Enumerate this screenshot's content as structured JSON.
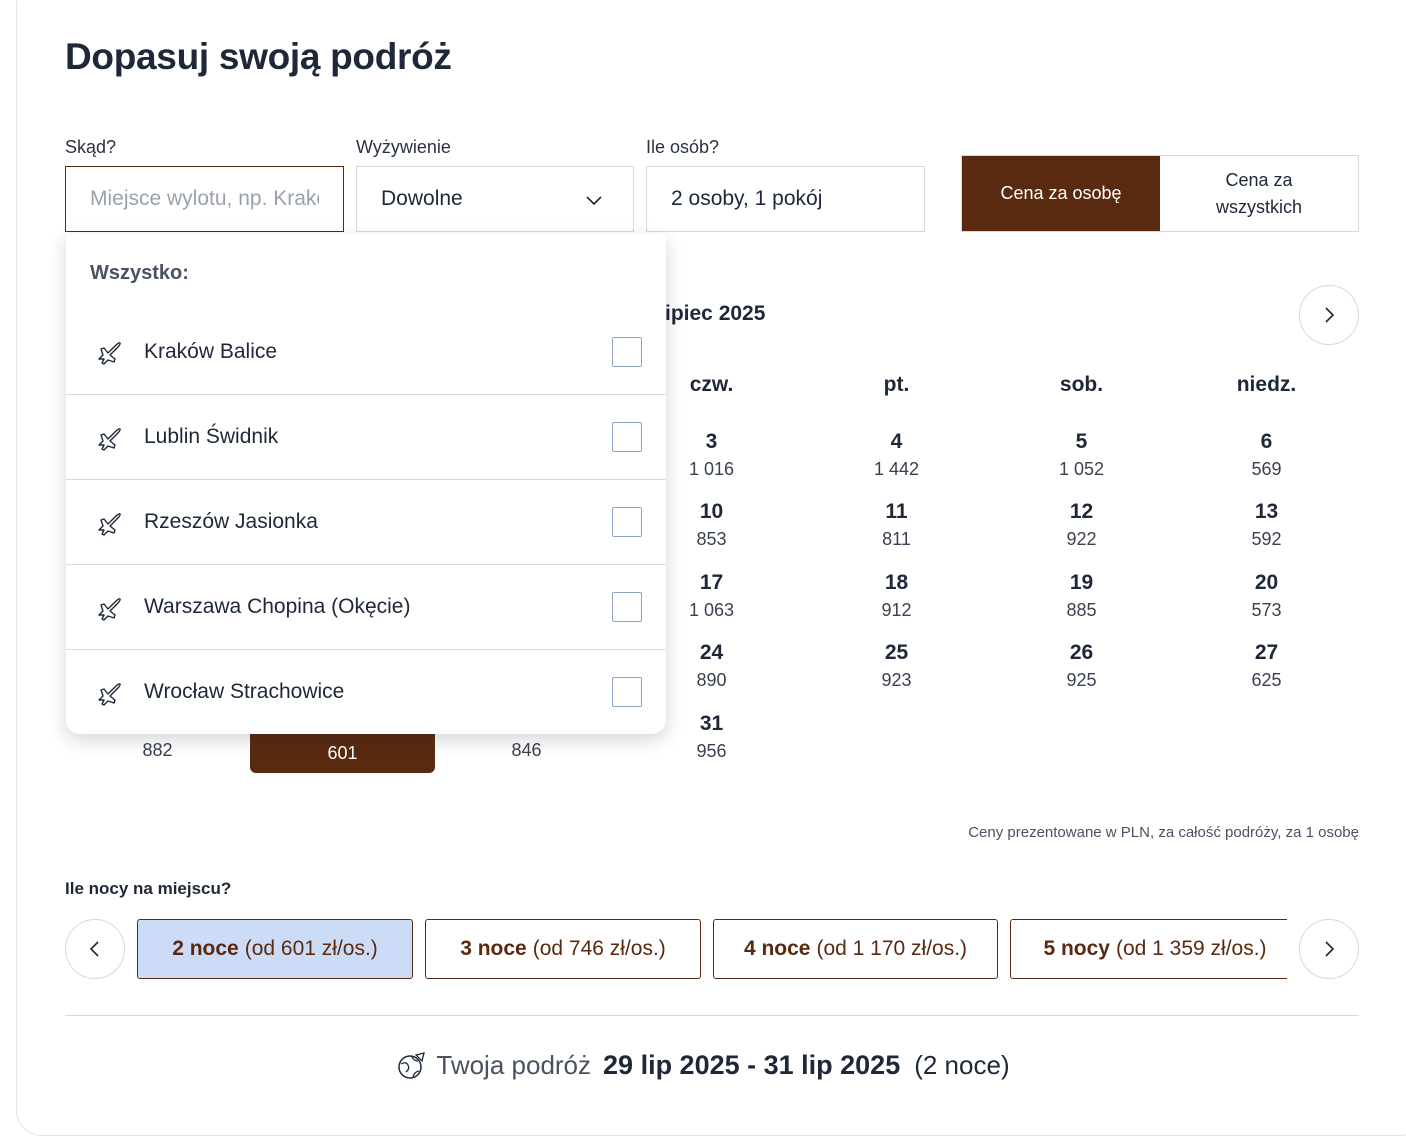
{
  "title": "Dopasuj swoją podróż",
  "from": {
    "label": "Skąd?",
    "placeholder": "Miejsce wylotu, np. Kraków"
  },
  "board": {
    "label": "Wyżywienie",
    "value": "Dowolne"
  },
  "people": {
    "label": "Ile osób?",
    "value": "2 osoby, 1 pokój"
  },
  "price_mode": {
    "per_person": "Cena za osobę",
    "total_line1": "Cena za",
    "total_line2": "wszystkich"
  },
  "calendar": {
    "month": "ipiec 2025",
    "weekdays": [
      "czw.",
      "pt.",
      "sob.",
      "niedz."
    ],
    "rows": [
      [
        {
          "d": "3",
          "p": "1 016"
        },
        {
          "d": "4",
          "p": "1 442"
        },
        {
          "d": "5",
          "p": "1 052"
        },
        {
          "d": "6",
          "p": "569"
        }
      ],
      [
        {
          "d": "10",
          "p": "853"
        },
        {
          "d": "11",
          "p": "811"
        },
        {
          "d": "12",
          "p": "922"
        },
        {
          "d": "13",
          "p": "592"
        }
      ],
      [
        {
          "d": "17",
          "p": "1 063"
        },
        {
          "d": "18",
          "p": "912"
        },
        {
          "d": "19",
          "p": "885"
        },
        {
          "d": "20",
          "p": "573"
        }
      ],
      [
        {
          "d": "24",
          "p": "890"
        },
        {
          "d": "25",
          "p": "923"
        },
        {
          "d": "26",
          "p": "925"
        },
        {
          "d": "27",
          "p": "625"
        }
      ],
      [
        {
          "d": "31",
          "p": "956"
        }
      ]
    ],
    "last_row_prices": [
      "882",
      "601",
      "846"
    ],
    "note": "Ceny prezentowane w PLN, za całość podróży, za 1 osobę"
  },
  "dropdown": {
    "header": "Wszystko:",
    "options": [
      "Kraków Balice",
      "Lublin Świdnik",
      "Rzeszów Jasionka",
      "Warszawa Chopina (Okęcie)",
      "Wrocław Strachowice"
    ]
  },
  "nights": {
    "label": "Ile nocy na miejscu?",
    "options": [
      {
        "n": "2 noce",
        "p": "(od 601 zł/os.)"
      },
      {
        "n": "3 noce",
        "p": "(od 746 zł/os.)"
      },
      {
        "n": "4 noce",
        "p": "(od 1 170 zł/os.)"
      },
      {
        "n": "5 nocy",
        "p": "(od 1 359 zł/os.)"
      }
    ]
  },
  "trip": {
    "label": "Twoja podróż",
    "dates": "29 lip 2025 - 31 lip 2025",
    "count": "(2 noce)"
  },
  "colors": {
    "accent": "#5a2a10",
    "selected_chip": "#ccdcf7",
    "border": "#d6d9de"
  },
  "icons": [
    "chevron-down-icon",
    "chevron-right-icon",
    "chevron-left-icon",
    "plane-icon",
    "globe-plane-icon"
  ]
}
